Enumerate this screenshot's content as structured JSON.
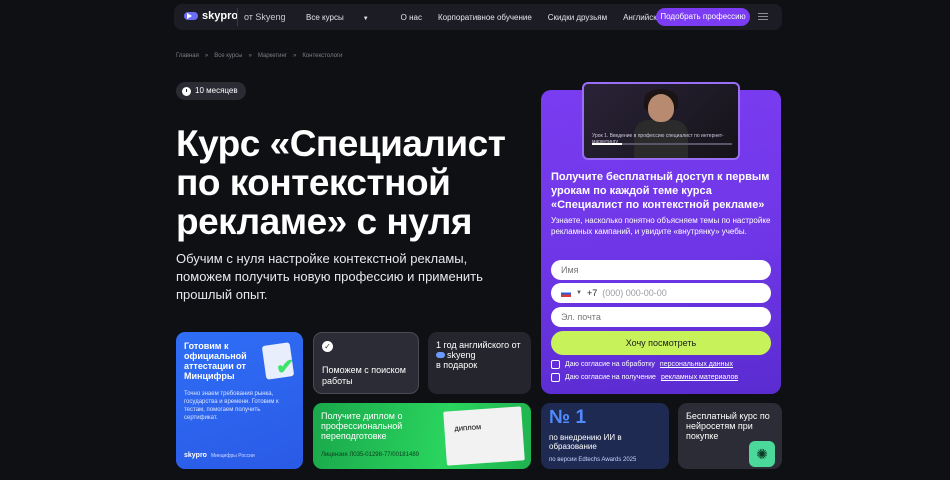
{
  "header": {
    "logo": "skypro",
    "from": "от Skyeng",
    "nav": [
      "Все курсы",
      "О нас",
      "Корпоративное обучение",
      "Скидки друзьям",
      "Английский язык"
    ],
    "cta": "Подобрать профессию"
  },
  "breadcrumbs": [
    "Главная",
    "»",
    "Все курсы",
    "»",
    "Маркетинг",
    "»",
    "Контекстологи"
  ],
  "duration": "10 месяцев",
  "title": "Курс «Специалист по контекстной рекламе» с нуля",
  "subtitle": "Обучим с нуля настройке контекстной рекламы, поможем получить новую профессию и применить прошлый опыт.",
  "cards": {
    "cert": {
      "heading": "Готовим к официальной аттестации от Минцифры",
      "text": "Точно знаем требования рынка, государства и времени. Готовим к тестам, помогаем получить сертификат.",
      "brand": "skypro",
      "partner": "Минцифры России"
    },
    "job": {
      "heading": "Поможем с поиском работы"
    },
    "english": {
      "pre": "1 год английского от",
      "brand": "skyeng",
      "post": "в подарок"
    },
    "diploma": {
      "heading": "Получите диплом о профессиональной переподготовке",
      "license": "Лицензия Л035-01298-77/00181489",
      "doc_label": "ДИПЛОМ"
    },
    "award": {
      "number": "№ 1",
      "heading": "по внедрению ИИ в образование",
      "sub": "по версии Edtechs Awards 2025"
    },
    "ai": {
      "heading": "Бесплатный курс по нейросетям при покупке"
    }
  },
  "promo": {
    "video_caption": "Урок 1. Введение в профессию специалист по интернет-маркетингу",
    "heading": "Получите бесплатный доступ к первым урокам по каждой теме курса «Специалист по контекстной рекламе»",
    "text": "Узнаете, насколько понятно объясняем темы по настройке рекламных кампаний, и увидите «внутрянку» учебы.",
    "name_placeholder": "Имя",
    "phone_prefix": "+7",
    "phone_placeholder": "(000) 000-00-00",
    "email_placeholder": "Эл. почта",
    "submit": "Хочу посмотреть",
    "agree1_pre": "Даю согласие на обработку",
    "agree1_link": "персональных данных",
    "agree2_pre": "Даю согласие на получение",
    "agree2_link": "рекламных материалов"
  },
  "colors": {
    "accent": "#7b3cf4",
    "lime": "#c8f25a",
    "blue": "#2f6ef6",
    "green": "#2ad45e"
  }
}
